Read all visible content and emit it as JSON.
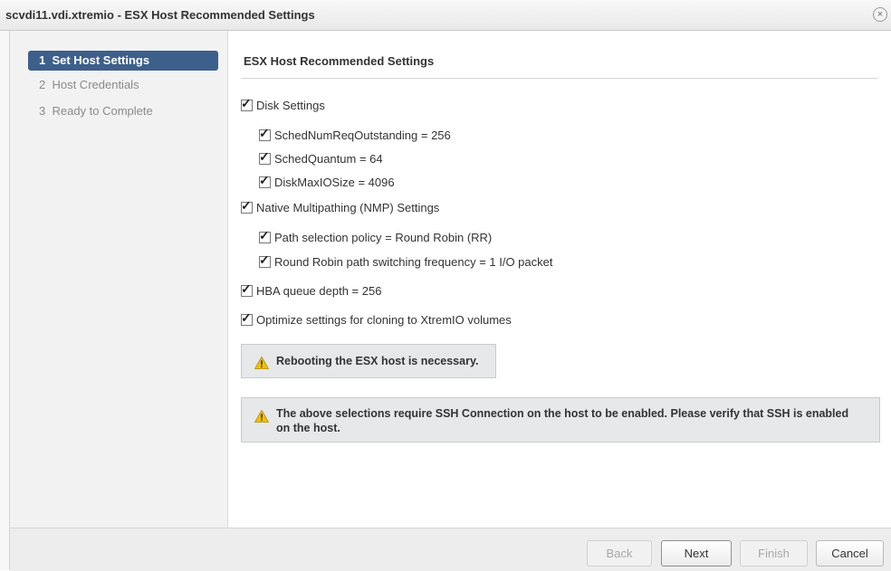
{
  "window": {
    "title": "scvdi11.vdi.xtremio - ESX Host Recommended Settings",
    "close_icon": "×"
  },
  "wizard_steps": [
    {
      "number": "1",
      "label": "Set Host Settings",
      "active": true
    },
    {
      "number": "2",
      "label": "Host Credentials",
      "active": false
    },
    {
      "number": "3",
      "label": "Ready to Complete",
      "active": false
    }
  ],
  "content": {
    "section_title": "ESX Host Recommended Settings",
    "settings": [
      {
        "label": "Disk Settings",
        "checked": true,
        "level": 0
      },
      {
        "label": "SchedNumReqOutstanding = 256",
        "checked": true,
        "level": 1
      },
      {
        "label": "SchedQuantum = 64",
        "checked": true,
        "level": 1
      },
      {
        "label": "DiskMaxIOSize = 4096",
        "checked": true,
        "level": 1
      },
      {
        "label": "Native Multipathing (NMP) Settings",
        "checked": true,
        "level": 0
      },
      {
        "label": "Path selection policy = Round Robin (RR)",
        "checked": true,
        "level": 1
      },
      {
        "label": "Round Robin path switching frequency = 1 I/O packet",
        "checked": true,
        "level": 1
      },
      {
        "label": "HBA queue depth = 256",
        "checked": true,
        "level": 0
      },
      {
        "label": "Optimize settings for cloning to XtremIO volumes",
        "checked": true,
        "level": 0
      }
    ],
    "warning_reboot": "Rebooting the ESX host is necessary.",
    "warning_ssh_line1": "The above selections require SSH Connection on the host to be enabled. Please verify that SSH is enabled",
    "warning_ssh_line2": "on the host.",
    "warning_icon": "warning-triangle-icon",
    "check_glyph": "✓"
  },
  "footer": {
    "back": "Back",
    "next": "Next",
    "finish": "Finish",
    "cancel": "Cancel"
  },
  "colors": {
    "active_step_bg": "#3d5f8b",
    "warning_yellow": "#f2c200"
  }
}
